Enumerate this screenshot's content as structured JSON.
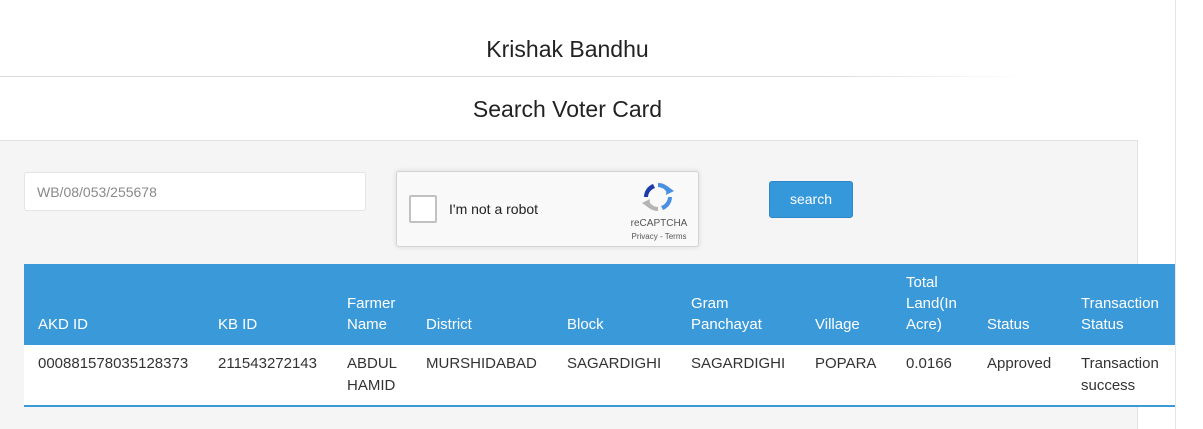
{
  "header": {
    "site_title": "Krishak Bandhu",
    "page_heading": "Search Voter Card"
  },
  "search": {
    "placeholder": "WB/08/053/255678",
    "value": "",
    "button_label": "search"
  },
  "recaptcha": {
    "label": "I'm not a robot",
    "brand": "reCAPTCHA",
    "privacy": "Privacy",
    "separator": " - ",
    "terms": "Terms",
    "checked": false
  },
  "table": {
    "columns": [
      "AKD ID",
      "KB ID",
      "Farmer Name",
      "District",
      "Block",
      "Gram Panchayat",
      "Village",
      "Total Land(In Acre)",
      "Status",
      "Transaction Status"
    ],
    "rows": [
      [
        "000881578035128373",
        "211543272143",
        "ABDUL HAMID",
        "MURSHIDABAD",
        "SAGARDIGHI",
        "SAGARDIGHI",
        "POPARA",
        "0.0166",
        "Approved",
        "Transaction success"
      ]
    ]
  },
  "colors": {
    "accent": "#3a99d8",
    "button": "#3498db",
    "panel_bg": "#f5f5f5"
  },
  "icons": {
    "recaptcha_logo": "recaptcha-logo-icon"
  }
}
